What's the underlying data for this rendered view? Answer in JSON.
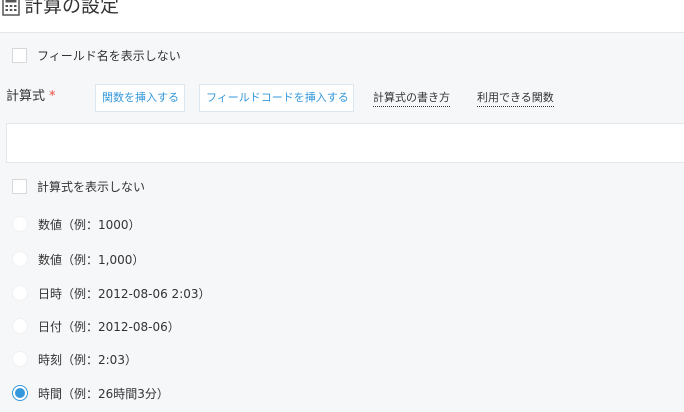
{
  "header": {
    "title": "計算の設定",
    "icon": "calculator-icon"
  },
  "options": {
    "hide_field_name": "フィールド名を表示しない",
    "hide_formula": "計算式を表示しない"
  },
  "formula": {
    "label": "計算式",
    "required_mark": "*",
    "insert_function": "関数を挿入する",
    "insert_field_code": "フィールドコードを挿入する",
    "how_to_write": "計算式の書き方",
    "available_functions": "利用できる関数",
    "value": ""
  },
  "display_format": {
    "options": [
      "数値（例：1000）",
      "数値（例：1,000）",
      "日時（例：2012-08-06 2:03）",
      "日付（例：2012-08-06）",
      "時刻（例：2:03）",
      "時間（例：26時間3分）"
    ],
    "selected_index": 5
  },
  "colors": {
    "accent": "#3498db",
    "required": "#e74c3c",
    "background": "#f6f7f9"
  }
}
